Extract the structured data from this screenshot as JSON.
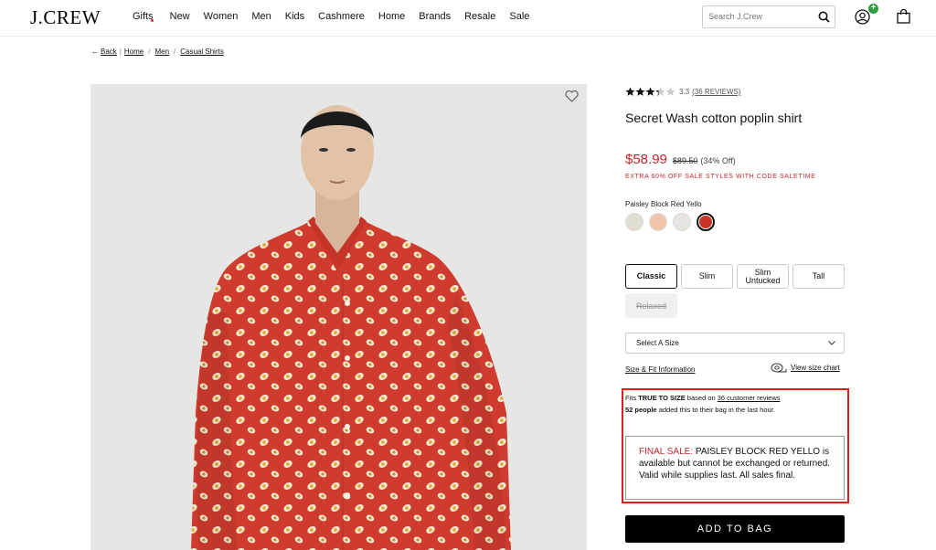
{
  "header": {
    "logo": "J.CREW",
    "nav": [
      "Gifts",
      "New",
      "Women",
      "Men",
      "Kids",
      "Cashmere",
      "Home",
      "Brands",
      "Resale",
      "Sale"
    ],
    "search_placeholder": "Search J.Crew",
    "account_badge": "+"
  },
  "breadcrumb": {
    "back": "Back",
    "items": [
      "Home",
      "Men",
      "Casual Shirts"
    ]
  },
  "product": {
    "rating_value": "3.3",
    "rating_stars": 3.3,
    "reviews_link": "(36 REVIEWS)",
    "title": "Secret Wash cotton poplin shirt",
    "sale_price": "$58.99",
    "original_price": "$89.50",
    "discount": "(34% Off)",
    "promo": "EXTRA 60% OFF SALE STYLES WITH CODE SALETIME",
    "color_name": "Paisley Block Red Yello",
    "swatch_colors": [
      "#e2ddd3",
      "#efc6ac",
      "#e7e4df",
      "#c9342a"
    ],
    "fits": [
      "Classic",
      "Slim",
      "Slim Untucked",
      "Tall"
    ],
    "fit_unavailable": "Relaxed",
    "size_select": "Select A Size",
    "size_fit_link": "Size & Fit Information",
    "size_chart_link": "View size chart",
    "fit_prefix": "Fits ",
    "fit_true": "TRUE TO SIZE",
    "fit_mid": " based on ",
    "fit_reviews": "36 customer reviews",
    "people_count": "52 people",
    "people_text": " added this to their bag in the last hour.",
    "final_sale_label": "FINAL SALE:",
    "final_sale_text": " PAISLEY BLOCK RED YELLO is available but cannot be exchanged or returned. Valid while supplies last. All sales final.",
    "add_to_bag": "ADD TO BAG"
  },
  "colors": {
    "sale_red": "#c0272d",
    "highlight_red": "#e01e1e",
    "shirt_red": "#cf3b2e"
  }
}
